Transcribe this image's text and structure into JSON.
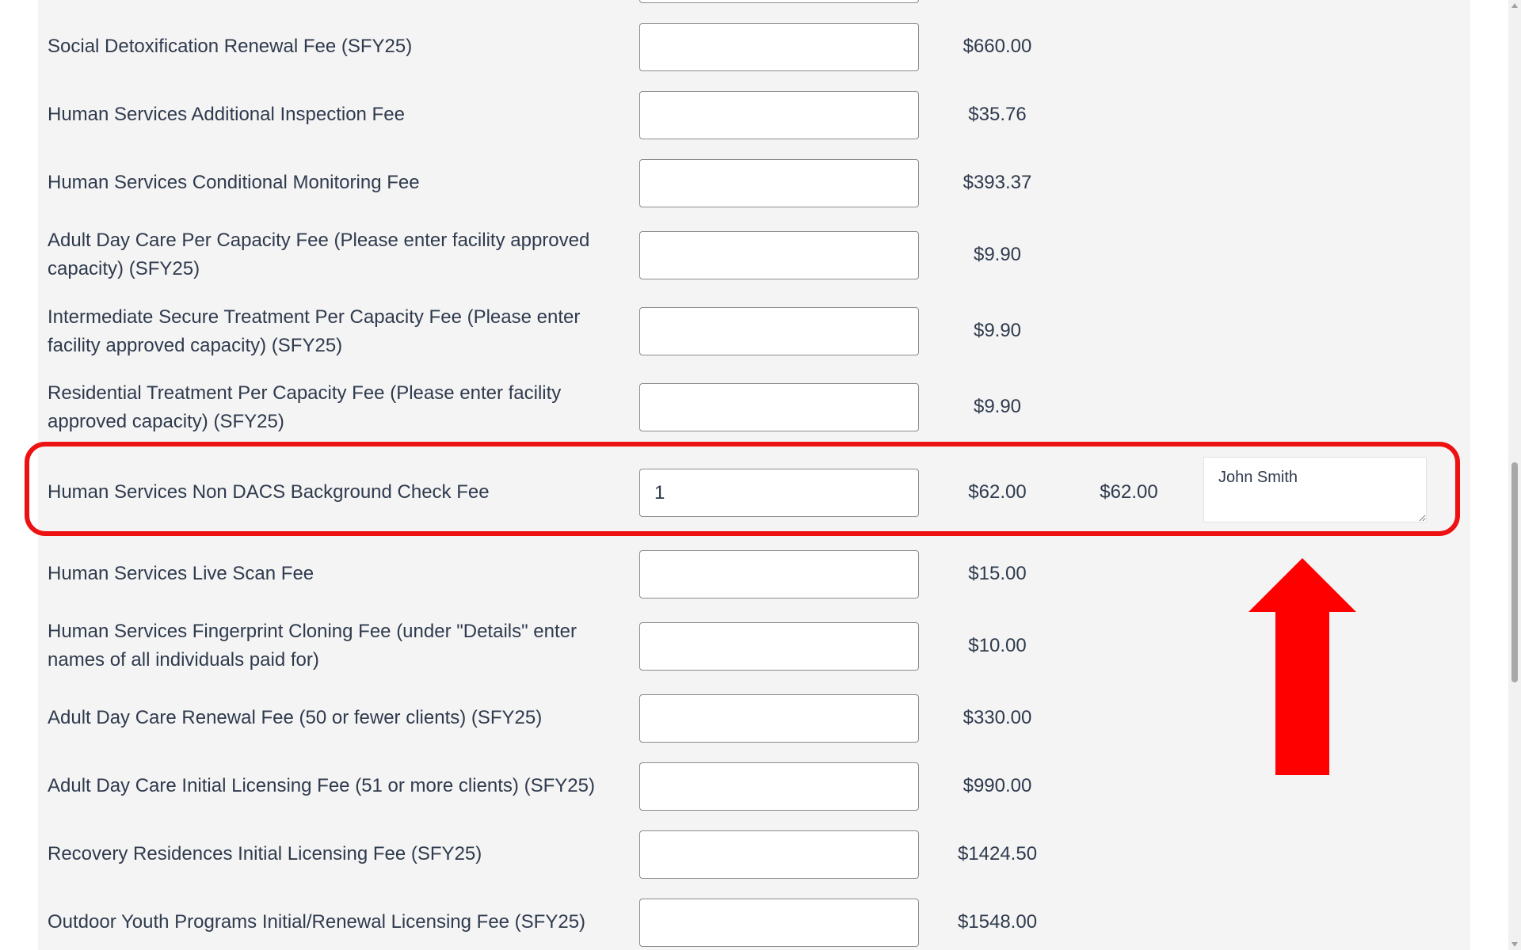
{
  "fee_rows": [
    {
      "label": "Social Detoxification Renewal Fee (SFY25)",
      "quantity": "",
      "price": "$660.00",
      "total": ""
    },
    {
      "label": "Human Services Additional Inspection Fee",
      "quantity": "",
      "price": "$35.76",
      "total": ""
    },
    {
      "label": "Human Services Conditional Monitoring Fee",
      "quantity": "",
      "price": "$393.37",
      "total": ""
    },
    {
      "label": "Adult Day Care Per Capacity Fee (Please enter facility approved capacity) (SFY25)",
      "quantity": "",
      "price": "$9.90",
      "total": ""
    },
    {
      "label": "Intermediate Secure Treatment Per Capacity Fee (Please enter facility approved capacity) (SFY25)",
      "quantity": "",
      "price": "$9.90",
      "total": ""
    },
    {
      "label": "Residential Treatment Per Capacity Fee (Please enter facility approved capacity) (SFY25)",
      "quantity": "",
      "price": "$9.90",
      "total": ""
    },
    {
      "label": "Human Services Non DACS Background Check Fee",
      "quantity": "1",
      "price": "$62.00",
      "total": "$62.00",
      "details": "John Smith"
    },
    {
      "label": "Human Services Live Scan Fee",
      "quantity": "",
      "price": "$15.00",
      "total": ""
    },
    {
      "label": "Human Services Fingerprint Cloning Fee (under \"Details\" enter names of all individuals paid for)",
      "quantity": "",
      "price": "$10.00",
      "total": ""
    },
    {
      "label": "Adult Day Care Renewal Fee (50 or fewer clients) (SFY25)",
      "quantity": "",
      "price": "$330.00",
      "total": ""
    },
    {
      "label": "Adult Day Care Initial Licensing Fee (51 or more clients) (SFY25)",
      "quantity": "",
      "price": "$990.00",
      "total": ""
    },
    {
      "label": "Recovery Residences Initial Licensing Fee (SFY25)",
      "quantity": "",
      "price": "$1424.50",
      "total": ""
    },
    {
      "label": "Outdoor Youth Programs Initial/Renewal Licensing Fee (SFY25)",
      "quantity": "",
      "price": "$1548.00",
      "total": ""
    }
  ],
  "annotation": {
    "highlight_color": "#ee1111",
    "arrow_color": "#ff0000",
    "arrow_direction": "up",
    "arrow_icon": "up-arrow-icon"
  },
  "colors": {
    "panel_background": "#f4f4f4",
    "text": "#2f3a4d",
    "input_border": "#8b8b8b"
  }
}
